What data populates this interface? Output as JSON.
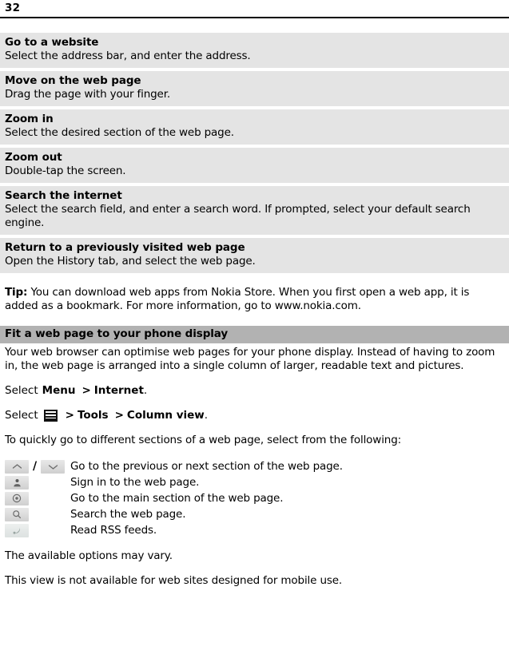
{
  "header": {
    "page_number": "32"
  },
  "task_table": {
    "rows": [
      {
        "title": "Go to a website",
        "desc": "Select the address bar, and enter the address."
      },
      {
        "title": "Move on the web page",
        "desc": "Drag the page with your finger."
      },
      {
        "title": "Zoom in",
        "desc": "Select the desired section of the web page."
      },
      {
        "title": "Zoom out",
        "desc": "Double-tap the screen."
      },
      {
        "title": "Search the internet",
        "desc": "Select the search field, and enter a search word. If prompted, select your default search engine."
      },
      {
        "title": "Return to a previously visited web page",
        "desc": "Open the History tab, and select the web page."
      }
    ]
  },
  "tip": {
    "label": "Tip:",
    "text": " You can download web apps from Nokia Store. When you first open a web app, it is added as a bookmark. For more information, go to www.nokia.com."
  },
  "section": {
    "heading": "Fit a web page to your phone display",
    "intro": "Your web browser can optimise web pages for your phone display. Instead of having to zoom in, the web page is arranged into a single column of larger, readable text and pictures."
  },
  "path_menu": {
    "lead": "Select",
    "item1": "Menu",
    "separator": ">",
    "item2": "Internet",
    "period": "."
  },
  "path_tools": {
    "lead": "Select",
    "icon": "menu-key-icon",
    "separator1": ">",
    "item1": "Tools",
    "separator2": ">",
    "item2": "Column view",
    "period": "."
  },
  "legend": {
    "intro": "To quickly go to different sections of a web page, select from the following:",
    "rows": [
      {
        "icons": [
          "chevron-up-icon",
          "chevron-down-icon"
        ],
        "separator": "/",
        "text": "Go to the previous or next section of the web page."
      },
      {
        "icons": [
          "person-sign-in-icon"
        ],
        "text": "Sign in to the web page."
      },
      {
        "icons": [
          "target-home-icon"
        ],
        "text": "Go to the main section of the web page."
      },
      {
        "icons": [
          "search-magnifier-icon"
        ],
        "text": "Search the web page."
      },
      {
        "icons": [
          "rss-feed-icon"
        ],
        "text": "Read RSS feeds."
      }
    ]
  },
  "footnotes": [
    "The available options may vary.",
    "This view is not available for web sites designed for mobile use."
  ],
  "colors": {
    "task_row_bg": "#e4e4e4",
    "section_band_bg": "#b2b2b2",
    "text": "#000000",
    "rule": "#000000"
  }
}
